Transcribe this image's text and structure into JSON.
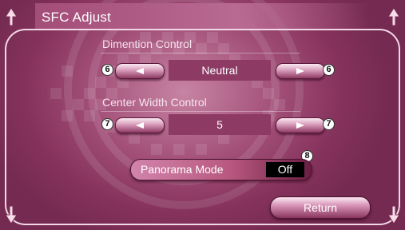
{
  "header": {
    "title": "SFC Adjust"
  },
  "dimension_control": {
    "label": "Dimention Control",
    "value": "Neutral",
    "callout": "6"
  },
  "center_width_control": {
    "label": "Center Width Control",
    "value": "5",
    "callout": "7"
  },
  "panorama": {
    "label": "Panorama Mode",
    "value": "Off",
    "callout": "8"
  },
  "return_label": "Return",
  "colors": {
    "background": "#8f3d68",
    "accent_light": "#f2d7e6",
    "value_box": "#8d3a65"
  },
  "icons": {
    "left": "left-arrow-icon",
    "right": "right-arrow-icon",
    "up": "up-arrow-icon",
    "down": "down-arrow-icon"
  }
}
